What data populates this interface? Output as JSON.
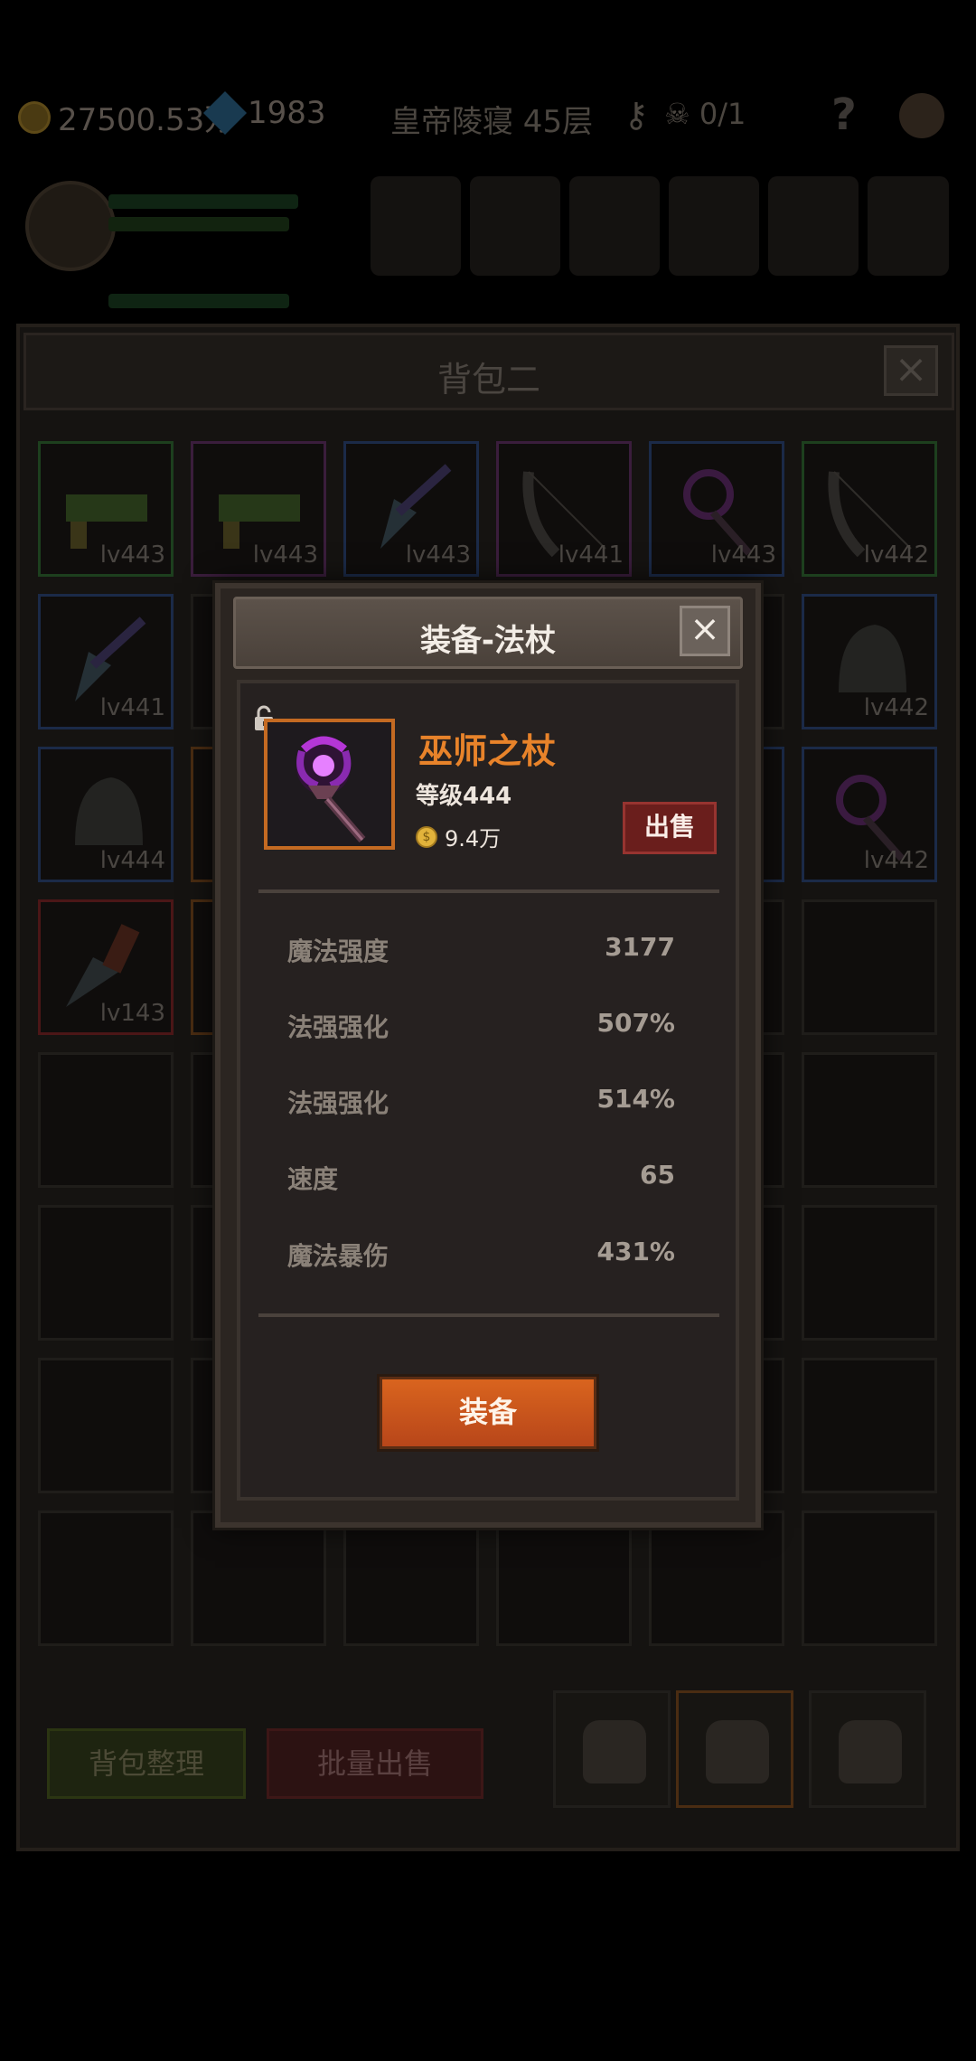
{
  "hud": {
    "gold": "27500.53万",
    "gems": "1983",
    "level_name": "皇帝陵寝 45层",
    "keys": "0/1",
    "help": "?"
  },
  "inventory": {
    "title": "背包二",
    "close": "×",
    "cells": [
      {
        "lv": "lv443",
        "rarity": "g"
      },
      {
        "lv": "lv443",
        "rarity": "p"
      },
      {
        "lv": "lv443",
        "rarity": "b"
      },
      {
        "lv": "lv441",
        "rarity": "p"
      },
      {
        "lv": "lv443",
        "rarity": "b"
      },
      {
        "lv": "lv442",
        "rarity": "g"
      },
      {
        "lv": "lv441",
        "rarity": "b"
      },
      {
        "lv": "lv442",
        "rarity": "b"
      },
      {
        "lv": "lv444",
        "rarity": "b"
      },
      {
        "lv": "lv442",
        "rarity": "b"
      },
      {
        "lv": "lv143",
        "rarity": "r"
      }
    ],
    "sort_button": "背包整理",
    "bulk_sell_button": "批量出售"
  },
  "modal": {
    "title": "装备-法杖",
    "close": "×",
    "item_name": "巫师之杖",
    "item_level": "等级444",
    "price": "9.4万",
    "sell_button": "出售",
    "stats": [
      {
        "label": "魔法强度",
        "value": "3177"
      },
      {
        "label": "法强强化",
        "value": "507%"
      },
      {
        "label": "法强强化",
        "value": "514%"
      },
      {
        "label": "速度",
        "value": "65"
      },
      {
        "label": "魔法暴伤",
        "value": "431%"
      }
    ],
    "equip_button": "装备"
  },
  "colors": {
    "item_name": "#e8832a",
    "equip_button": "#d9641e",
    "sell_button": "#6a1e1c",
    "legendary_border": "#c46a22"
  },
  "icons": [
    "coin-icon",
    "gem-icon",
    "key-icon",
    "skull-icon",
    "help-icon",
    "settings-icon",
    "lock-icon",
    "staff-icon",
    "close-icon",
    "backpack-icon"
  ]
}
